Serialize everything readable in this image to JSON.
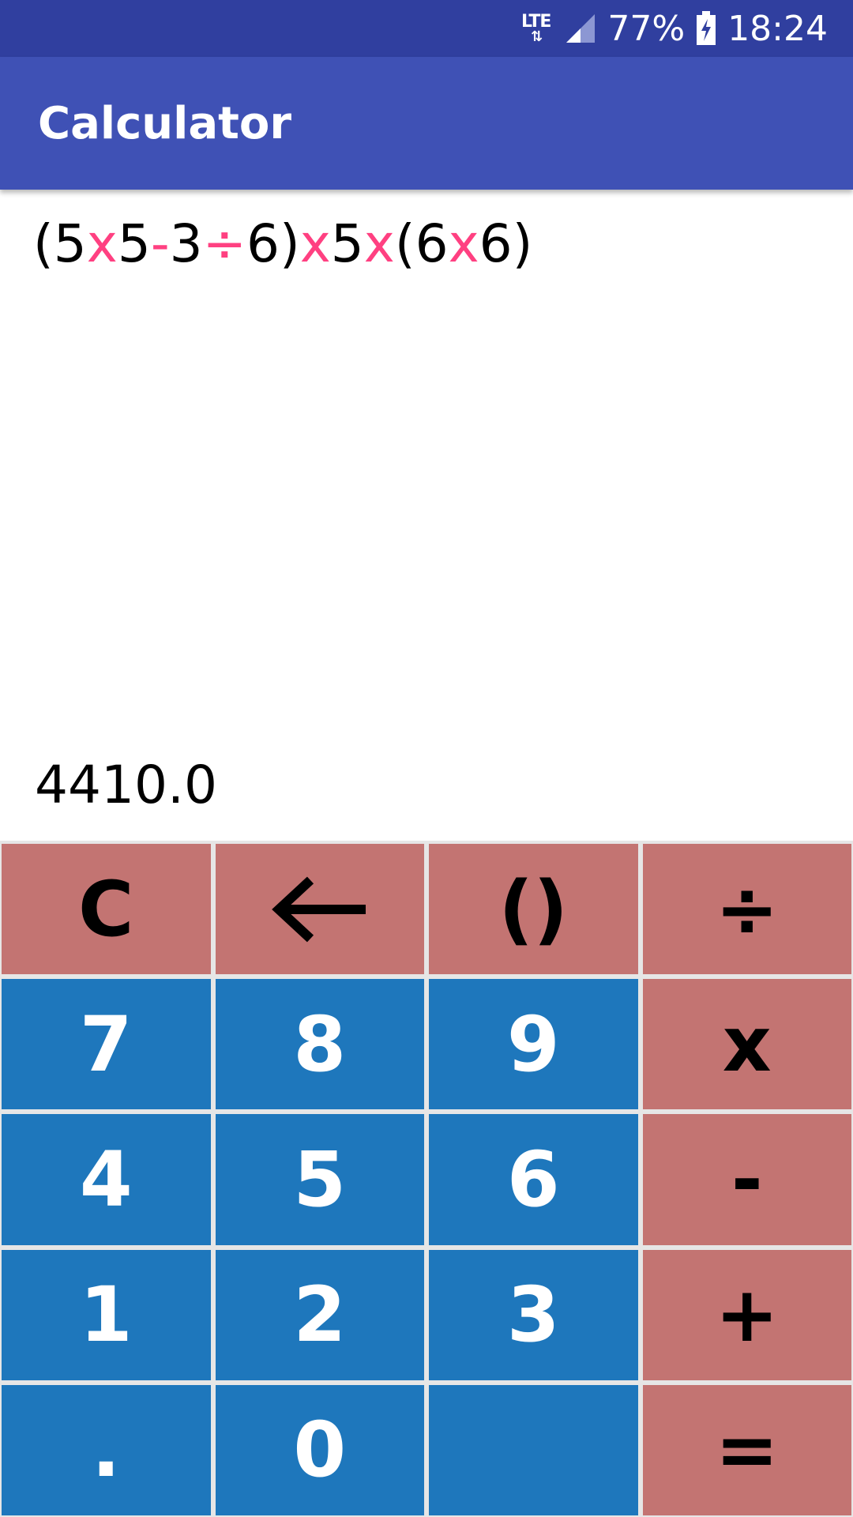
{
  "status_bar": {
    "network_type": "LTE",
    "network_arrows": "⇅",
    "battery_percent": "77%",
    "time": "18:24",
    "icons": [
      "network-lte-icon",
      "signal-icon",
      "battery-charging-icon"
    ]
  },
  "app_bar": {
    "title": "Calculator"
  },
  "display": {
    "expression_tokens": [
      {
        "text": "(5",
        "op": false
      },
      {
        "text": "x",
        "op": true
      },
      {
        "text": "5",
        "op": false
      },
      {
        "text": "-",
        "op": true
      },
      {
        "text": "3",
        "op": false
      },
      {
        "text": "÷",
        "op": true
      },
      {
        "text": "6)",
        "op": false
      },
      {
        "text": "x",
        "op": true
      },
      {
        "text": "5",
        "op": false
      },
      {
        "text": "x",
        "op": true
      },
      {
        "text": "(6",
        "op": false
      },
      {
        "text": "x",
        "op": true
      },
      {
        "text": "6)",
        "op": false
      }
    ],
    "result": "4410.0"
  },
  "keypad": {
    "clear": "C",
    "backspace_icon": "backspace-arrow-icon",
    "parens": "()",
    "divide": "÷",
    "seven": "7",
    "eight": "8",
    "nine": "9",
    "multiply": "x",
    "four": "4",
    "five": "5",
    "six": "6",
    "minus": "-",
    "one": "1",
    "two": "2",
    "three": "3",
    "plus": "+",
    "dot": ".",
    "zero": "0",
    "blank": "",
    "equals": "="
  },
  "colors": {
    "status_bar": "#303f9f",
    "app_bar": "#3f51b5",
    "number_key": "#1e77bc",
    "operator_key": "#c37472",
    "expression_operator": "#ff4081"
  }
}
